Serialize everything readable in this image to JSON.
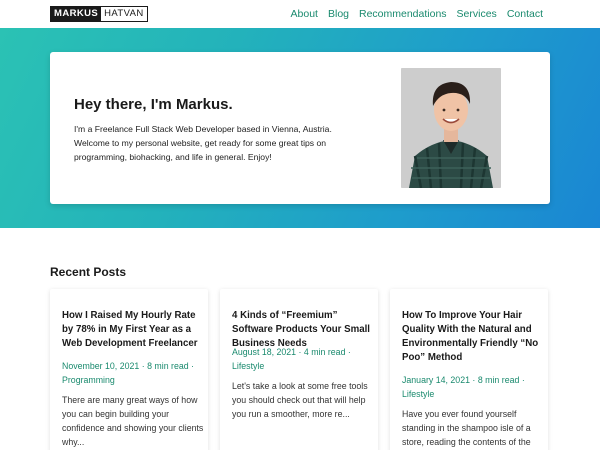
{
  "header": {
    "logo_first": "MARKUS",
    "logo_last": "HATVAN",
    "nav": [
      "About",
      "Blog",
      "Recommendations",
      "Services",
      "Contact"
    ]
  },
  "hero": {
    "title": "Hey there, I'm Markus.",
    "text": "I'm a Freelance Full Stack Web Developer based in Vienna, Austria. Welcome to my personal website, get ready for some great tips on programming, biohacking, and life in general. Enjoy!"
  },
  "recent": {
    "title": "Recent Posts",
    "posts": [
      {
        "title": "How I Raised My Hourly Rate by 78% in My First Year as a Web Development Freelancer",
        "date": "November 10, 2021",
        "read": "8 min read",
        "category": "Programming",
        "excerpt": "There are many great ways of how you can begin building your confidence and showing your clients why..."
      },
      {
        "title": "4 Kinds of “Freemium” Software Products Your Small Business Needs",
        "date": "August 18, 2021",
        "read": "4 min read",
        "category": "Lifestyle",
        "excerpt": "Let's take a look at some free tools you should check out that will help you run a smoother, more re..."
      },
      {
        "title": "How To Improve Your Hair Quality With the Natural and Environmentally Friendly “No Poo” Method",
        "date": "January 14, 2021",
        "read": "8 min read",
        "category": "Lifestyle",
        "excerpt": "Have you ever found yourself standing in the shampoo isle of a store, reading the contents of the"
      }
    ]
  },
  "colors": {
    "accent": "#1a8a6e",
    "gradient_start": "#2bc2b4",
    "gradient_end": "#1a86d3"
  }
}
